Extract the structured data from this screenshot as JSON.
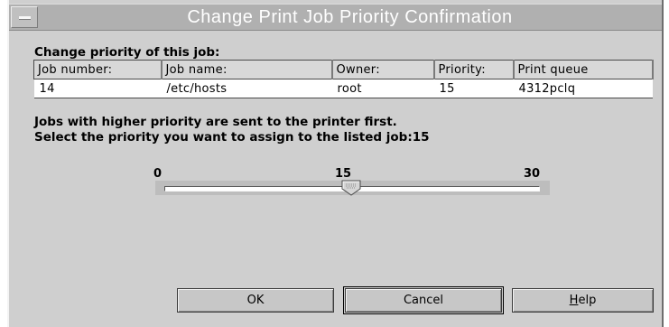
{
  "dialog": {
    "title": "Change Print Job Priority Confirmation",
    "heading": "Change priority of this job:",
    "message_line1": "Jobs with higher priority are sent to the printer first.",
    "message_line2": "Select the priority you want to assign to the listed job:15"
  },
  "table": {
    "columns": [
      "Job number:",
      "Job name:",
      "Owner:",
      "Priority:",
      "Print queue"
    ],
    "rows": [
      [
        "14",
        "/etc/hosts",
        "root",
        "15",
        "4312pclq"
      ]
    ]
  },
  "slider": {
    "min_label": "0",
    "mid_label": "15",
    "max_label": "30",
    "min": 0,
    "max": 30,
    "value": 15
  },
  "buttons": {
    "ok": "OK",
    "cancel": "Cancel",
    "help_mnemonic": "H",
    "help_rest": "elp"
  }
}
